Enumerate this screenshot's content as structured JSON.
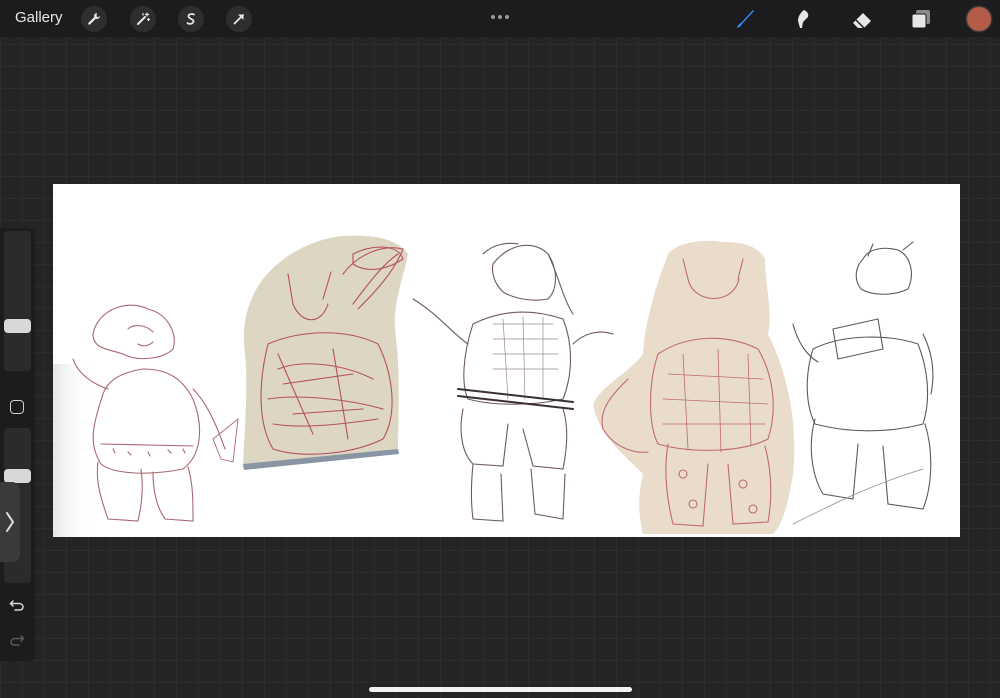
{
  "topbar": {
    "gallery_label": "Gallery",
    "left_tools": [
      "wrench-icon",
      "magic-wand-icon",
      "selection-icon",
      "transform-arrow-icon"
    ],
    "right_tools": [
      "brush-icon",
      "smudge-icon",
      "eraser-icon",
      "layers-icon"
    ],
    "active_tool": "brush-icon",
    "accent_color": "#2f8cff",
    "current_color": "#b55c48"
  },
  "sidebar": {
    "brush_size_level": 0.3,
    "opacity_level": 0.3,
    "buttons": [
      "modify-square-icon",
      "undo-icon",
      "redo-icon"
    ],
    "expand_icon": "chevron-right-icon"
  },
  "canvas": {
    "background": "#ffffff",
    "sketch_color": "#a8505a",
    "content": "sketch-of-five-characters"
  }
}
